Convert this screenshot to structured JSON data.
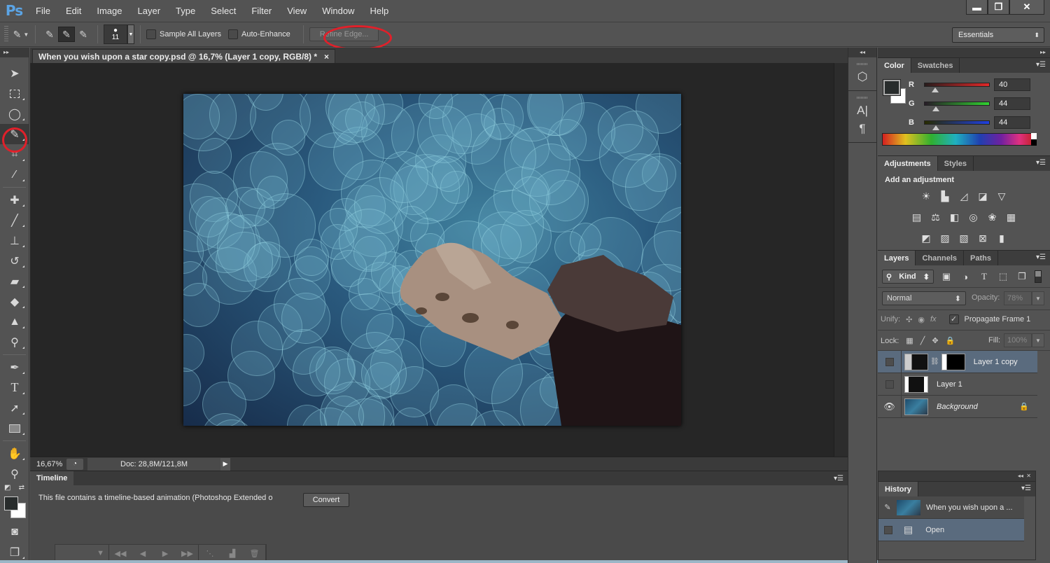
{
  "app": {
    "logo": "Ps"
  },
  "menu": [
    "File",
    "Edit",
    "Image",
    "Layer",
    "Type",
    "Select",
    "Filter",
    "View",
    "Window",
    "Help"
  ],
  "window_controls": {
    "minimize": "▬",
    "restore": "❐",
    "close": "✕"
  },
  "options_bar": {
    "brush_size": "11",
    "sample_all_layers": {
      "label": "Sample All Layers",
      "checked": false
    },
    "auto_enhance": {
      "label": "Auto-Enhance",
      "checked": false
    },
    "refine_edge": "Refine Edge...",
    "workspace": "Essentials"
  },
  "document": {
    "tab_title": "When you wish upon a star copy.psd @ 16,7% (Layer 1 copy, RGB/8) *",
    "close": "×"
  },
  "tools": [
    "move",
    "rectangular-marquee",
    "lasso",
    "quick-selection",
    "crop",
    "eyedropper",
    "spot-healing-brush",
    "brush",
    "clone-stamp",
    "history-brush",
    "eraser",
    "paint-bucket",
    "blur",
    "dodge",
    "pen",
    "type",
    "path-selection",
    "rectangle",
    "hand",
    "zoom"
  ],
  "status_bar": {
    "zoom": "16,67%",
    "doc_size": "Doc: 28,8M/121,8M"
  },
  "timeline": {
    "tab": "Timeline",
    "message": "This file contains a timeline-based animation (Photoshop Extended o",
    "convert_label": "Convert"
  },
  "color_panel": {
    "tabs": [
      "Color",
      "Swatches"
    ],
    "active_tab": "Color",
    "channels": [
      {
        "label": "R",
        "value": "40",
        "color": "#e02828"
      },
      {
        "label": "G",
        "value": "44",
        "color": "#30d030"
      },
      {
        "label": "B",
        "value": "44",
        "color": "#2040e0"
      }
    ],
    "foreground": "#282c2c",
    "background": "#ffffff"
  },
  "adjustments_panel": {
    "tabs": [
      "Adjustments",
      "Styles"
    ],
    "active_tab": "Adjustments",
    "title": "Add an adjustment",
    "rows": [
      [
        "brightness-contrast",
        "levels",
        "curves",
        "exposure",
        "vibrance"
      ],
      [
        "hue-saturation",
        "color-balance",
        "black-white",
        "photo-filter",
        "channel-mixer",
        "color-lookup"
      ],
      [
        "invert",
        "posterize",
        "threshold",
        "selective-color",
        "gradient-map"
      ]
    ]
  },
  "layers_panel": {
    "tabs": [
      "Layers",
      "Channels",
      "Paths"
    ],
    "active_tab": "Layers",
    "filter_kind": "Kind",
    "blend_mode": "Normal",
    "opacity_label": "Opacity:",
    "opacity": "78%",
    "unify_label": "Unify:",
    "propagate_label": "Propagate Frame 1",
    "propagate_checked": true,
    "lock_label": "Lock:",
    "fill_label": "Fill:",
    "fill": "100%",
    "layers": [
      {
        "name": "Layer 1 copy",
        "visible": false,
        "selected": true,
        "has_mask": true,
        "locked": false,
        "italic": false
      },
      {
        "name": "Layer 1",
        "visible": false,
        "selected": false,
        "has_mask": false,
        "locked": false,
        "italic": false
      },
      {
        "name": "Background",
        "visible": true,
        "selected": false,
        "has_mask": false,
        "locked": true,
        "italic": true
      }
    ]
  },
  "history_panel": {
    "tab": "History",
    "snapshot": "When you wish upon a ...",
    "states": [
      "Open"
    ]
  }
}
